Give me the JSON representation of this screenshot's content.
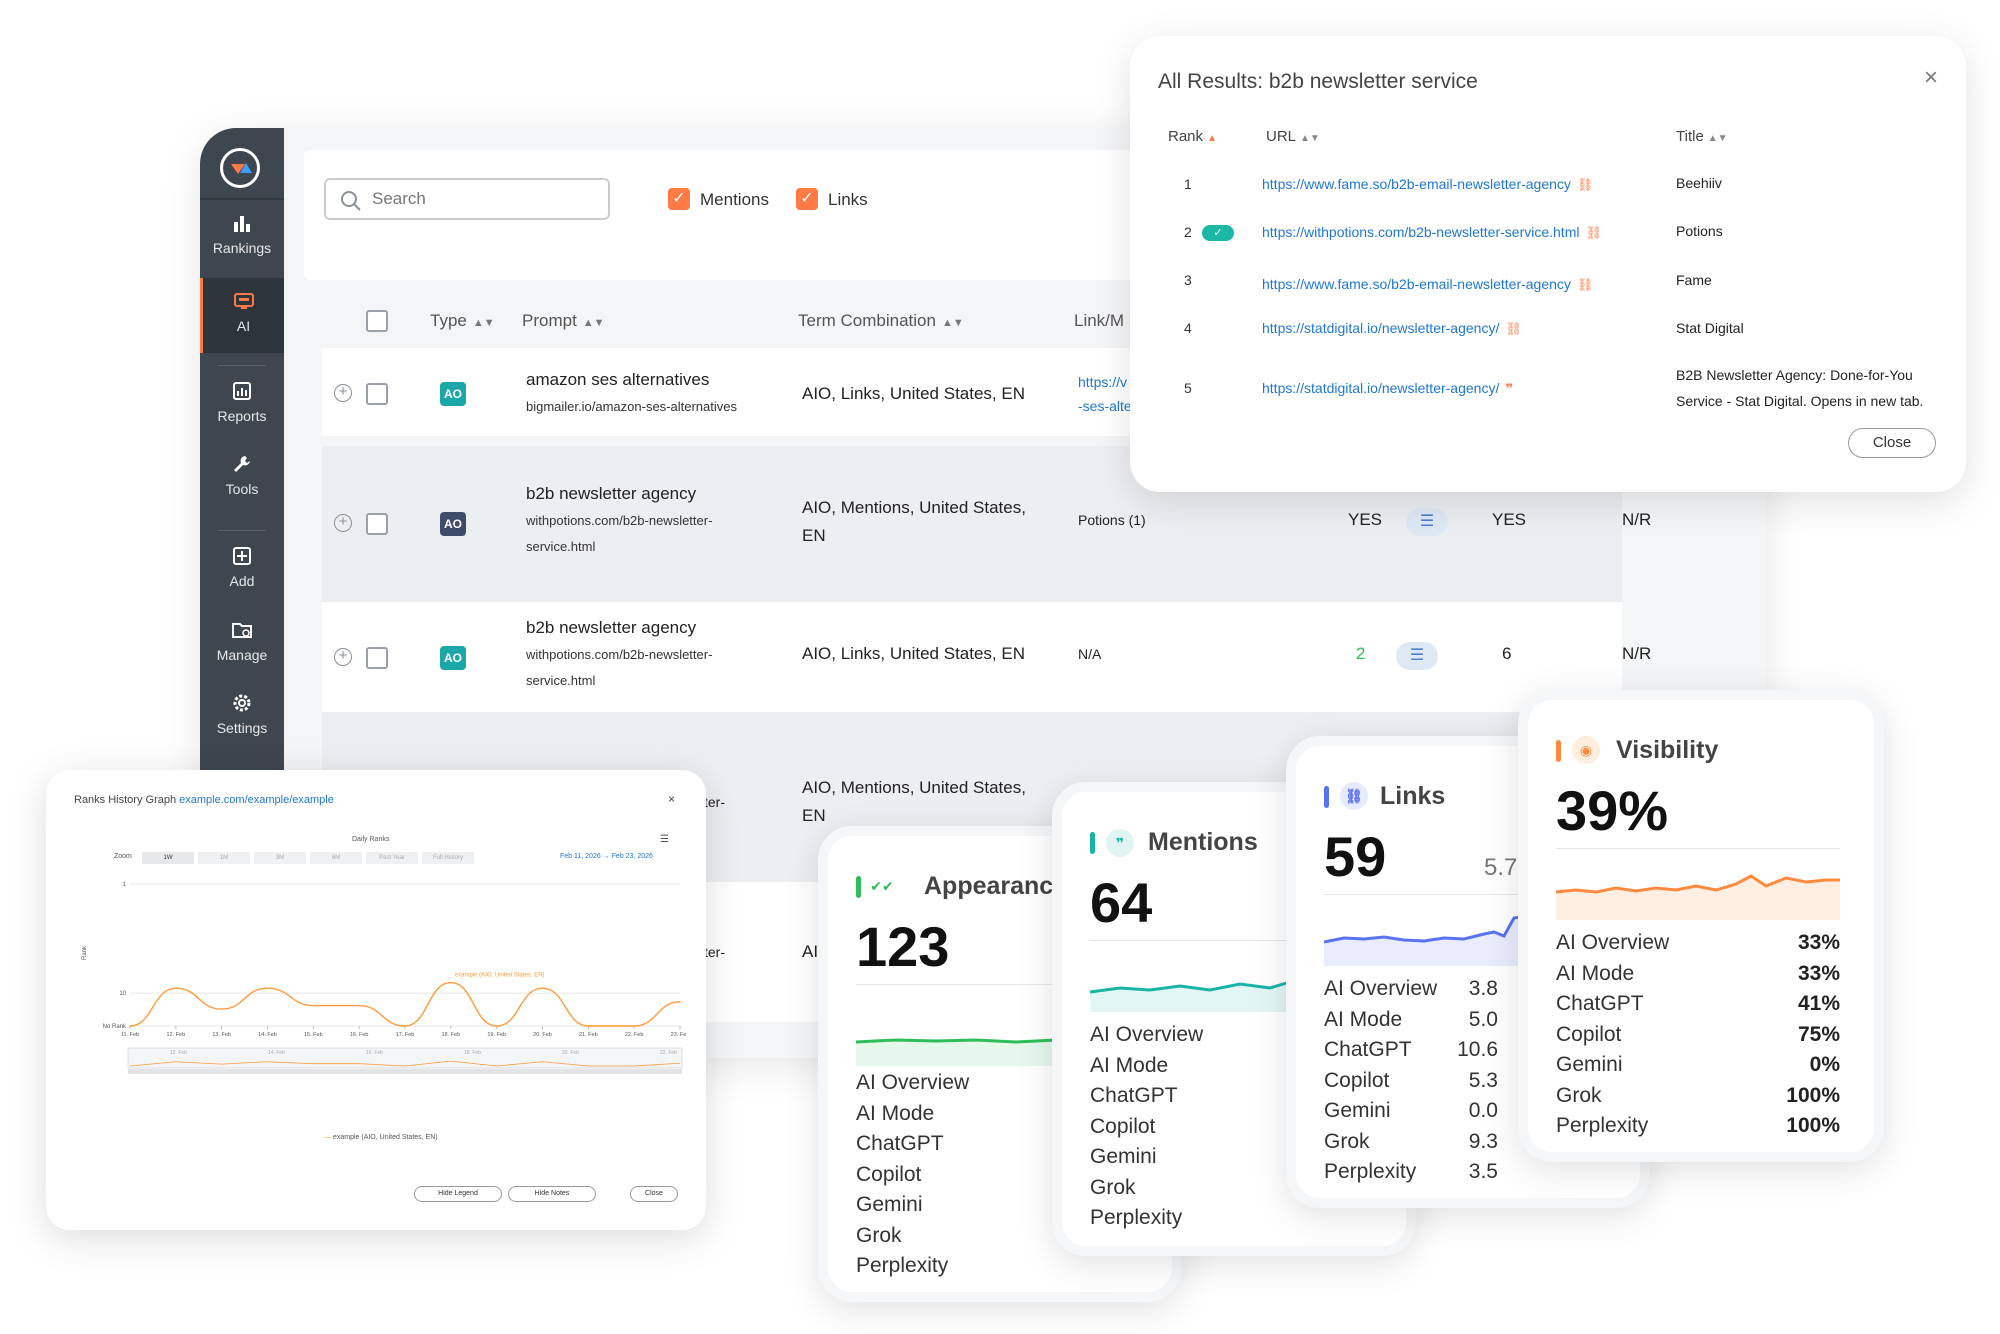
{
  "sidebar": {
    "items": [
      {
        "label": "Rankings",
        "icon": "bar-chart-icon"
      },
      {
        "label": "AI",
        "icon": "monitor-icon"
      },
      {
        "label": "Reports",
        "icon": "report-icon"
      },
      {
        "label": "Tools",
        "icon": "wrench-icon"
      },
      {
        "label": "Add",
        "icon": "plus-square-icon"
      },
      {
        "label": "Manage",
        "icon": "folder-gear-icon"
      },
      {
        "label": "Settings",
        "icon": "gear-icon"
      }
    ]
  },
  "toolbar": {
    "search_placeholder": "Search",
    "mentions_label": "Mentions",
    "links_label": "Links"
  },
  "table": {
    "headers": {
      "type": "Type",
      "prompt": "Prompt",
      "term": "Term Combination",
      "link": "Link/M"
    },
    "rows": [
      {
        "type": "AO",
        "title": "amazon ses alternatives",
        "url1": "bigmailer.io/amazon-ses-alternatives",
        "url2": "",
        "term1": "AIO, Links, United States, EN",
        "term2": "",
        "link1": "https://v",
        "link2": "-ses-alte"
      },
      {
        "type": "AO",
        "title": "b2b newsletter agency",
        "url1": "withpotions.com/b2b-newsletter-",
        "url2": "service.html",
        "term1": "AIO, Mentions, United States,",
        "term2": "EN",
        "link": "Potions (1)",
        "col1": "YES",
        "col2": "YES",
        "col3": "N/R"
      },
      {
        "type": "AO",
        "title": "b2b newsletter agency",
        "url1": "withpotions.com/b2b-newsletter-",
        "url2": "service.html",
        "term1": "AIO, Links, United States, EN",
        "link": "N/A",
        "col1": "2",
        "col2": "6",
        "col3": "N/R"
      },
      {
        "partial1": "ter-",
        "term1": "AIO, Mentions, United States,",
        "term2": "EN"
      },
      {
        "partial1": "ter-",
        "term1": "AI"
      }
    ]
  },
  "results": {
    "title": "All Results: b2b newsletter service",
    "close_x": "×",
    "headers": {
      "rank": "Rank",
      "url": "URL",
      "title": "Title"
    },
    "rows": [
      {
        "rank": "1",
        "url": "https://www.fame.so/b2b-email-newsletter-agency",
        "icon": "link-icon",
        "title1": "Beehiiv",
        "title2": ""
      },
      {
        "rank": "2",
        "url": "https://withpotions.com/b2b-newsletter-service.html",
        "icon": "link-icon",
        "title1": "Potions",
        "title2": ""
      },
      {
        "rank": "3",
        "url": "https://www.fame.so/b2b-email-newsletter-agency",
        "icon": "link-icon",
        "title1": "Fame",
        "title2": ""
      },
      {
        "rank": "4",
        "url": "https://statdigital.io/newsletter-agency/",
        "icon": "link-icon",
        "title1": "Stat Digital",
        "title2": ""
      },
      {
        "rank": "5",
        "url": "https://statdigital.io/newsletter-agency/",
        "icon": "quote-icon",
        "title1": "B2B Newsletter Agency: Done-for-You",
        "title2": "Service - Stat Digital. Opens in new tab."
      }
    ],
    "close_label": "Close"
  },
  "ranks_graph": {
    "title": "Ranks History Graph",
    "title_link": "example.com/example/example",
    "close_x": "×",
    "chart_title": "Daily Ranks",
    "zoom_label": "Zoom",
    "zoom_options": [
      "1W",
      "1M",
      "3M",
      "6M",
      "Past Year",
      "Full History"
    ],
    "date_from": "Feb 11, 2026",
    "date_arrow": "→",
    "date_to": "Feb 23, 2026",
    "y_label": "Rank",
    "y_ticks": [
      "1",
      "10",
      "No Rank"
    ],
    "x_ticks": [
      "11. Feb",
      "12. Feb",
      "13. Feb",
      "14. Feb",
      "15. Feb",
      "16. Feb",
      "17. Feb",
      "18. Feb",
      "19. Feb",
      "20. Feb",
      "21. Feb",
      "22. Feb",
      "23. Feb"
    ],
    "nav_ticks": [
      "12. Feb",
      "14. Feb",
      "16. Feb",
      "18. Feb",
      "20. Feb",
      "22. Feb"
    ],
    "series_label": "example (AIO, United States, EN)",
    "legend": "example (AIO, United States, EN)",
    "buttons": {
      "hide_legend": "Hide Legend",
      "hide_notes": "Hide Notes",
      "close": "Close"
    }
  },
  "chart_data": {
    "type": "line",
    "title": "Daily Ranks",
    "xlabel": "",
    "ylabel": "Rank",
    "x": [
      "11. Feb",
      "12. Feb",
      "13. Feb",
      "14. Feb",
      "15. Feb",
      "16. Feb",
      "17. Feb",
      "18. Feb",
      "19. Feb",
      "20. Feb",
      "21. Feb",
      "22. Feb",
      "23. Feb"
    ],
    "series": [
      {
        "name": "example (AIO, United States, EN)",
        "values": [
          20,
          9,
          14,
          9,
          13,
          13,
          20,
          8,
          20,
          9,
          20,
          20,
          12
        ]
      }
    ],
    "y_scale": "log",
    "ylim": [
      1,
      20
    ],
    "y_tick_labels": [
      "1",
      "10",
      "No Rank"
    ],
    "color": "#ff9a3c",
    "note": "values of 20 represent No Rank"
  },
  "cards": {
    "appearances": {
      "title": "Appearances",
      "value": "123",
      "items": [
        "AI Overview",
        "AI Mode",
        "ChatGPT",
        "Copilot",
        "Gemini",
        "Grok",
        "Perplexity"
      ],
      "color": "#2ebd59"
    },
    "mentions": {
      "title": "Mentions",
      "value": "64",
      "items": [
        "AI Overview",
        "AI Mode",
        "ChatGPT",
        "Copilot",
        "Gemini",
        "Grok",
        "Perplexity"
      ],
      "color": "#19b3a8"
    },
    "links": {
      "title": "Links",
      "value": "59",
      "sub": "5.7",
      "items": [
        "AI Overview",
        "AI Mode",
        "ChatGPT",
        "Copilot",
        "Gemini",
        "Grok",
        "Perplexity"
      ],
      "vals": [
        "3.8",
        "5.0",
        "10.6",
        "5.3",
        "0.0",
        "9.3",
        "3.5"
      ],
      "color": "#5a73f0"
    },
    "visibility": {
      "title": "Visibility",
      "value": "39%",
      "items": [
        "AI Overview",
        "AI Mode",
        "ChatGPT",
        "Copilot",
        "Gemini",
        "Grok",
        "Perplexity"
      ],
      "vals": [
        "33%",
        "33%",
        "41%",
        "75%",
        "0%",
        "100%",
        "100%"
      ],
      "color": "#ff8a3d"
    }
  }
}
